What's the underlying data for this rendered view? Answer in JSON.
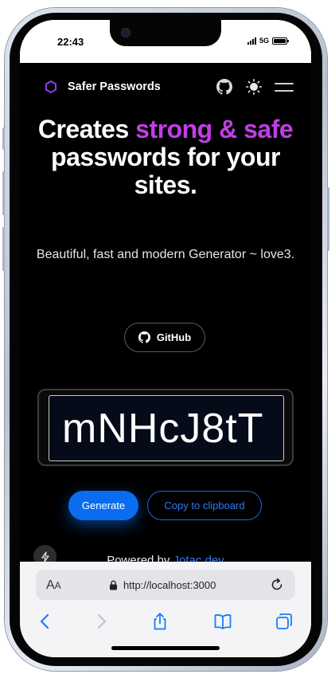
{
  "status_bar": {
    "time": "22:43",
    "network": "5G"
  },
  "app": {
    "brand": "Safer Passwords",
    "hero": {
      "line1": "Creates",
      "accent": "strong & safe",
      "line2": "passwords for your sites."
    },
    "subtitle": "Beautiful, fast and modern Generator ~ love3.",
    "github_label": "GitHub",
    "password_value": "mNHcJ8tT",
    "generate_label": "Generate",
    "copy_label": "Copy to clipboard",
    "powered_prefix": "Powered by",
    "powered_link": "Jotac.dev"
  },
  "browser": {
    "text_size_big": "A",
    "text_size_small": "A",
    "url": "http://localhost:3000"
  },
  "colors": {
    "accent_purple": "#c03ee6",
    "primary_blue": "#0a6df0",
    "safari_blue": "#1a7cf5"
  },
  "icons": [
    "hexagon-logo-icon",
    "github-icon",
    "sun-icon",
    "menu-icon",
    "bolt-icon",
    "lock-icon",
    "reload-icon",
    "back-icon",
    "forward-icon",
    "share-icon",
    "bookmarks-icon",
    "tabs-icon"
  ]
}
